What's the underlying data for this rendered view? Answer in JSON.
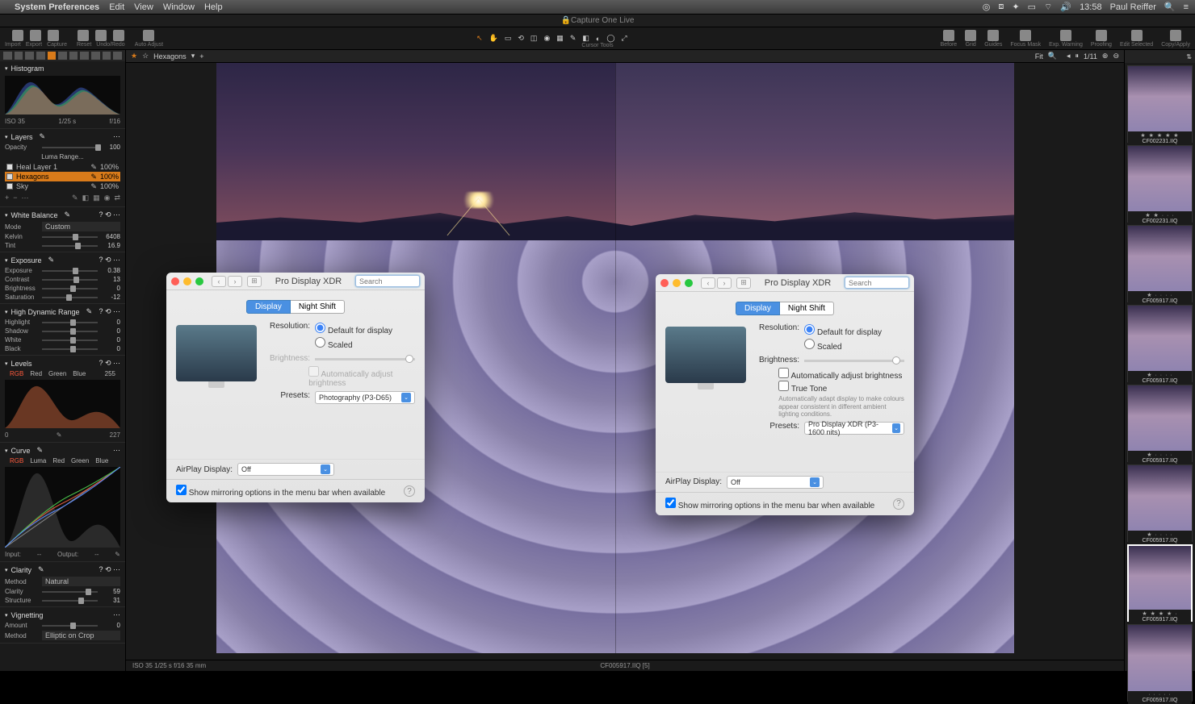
{
  "menubar": {
    "app": "System Preferences",
    "items": [
      "Edit",
      "View",
      "Window",
      "Help"
    ],
    "clock": "13:58",
    "user": "Paul Reiffer"
  },
  "app_title": "Capture One Live",
  "toolbar_left": [
    {
      "label": "Import"
    },
    {
      "label": "Export"
    },
    {
      "label": "Capture"
    }
  ],
  "toolbar_mid": [
    {
      "label": "Reset"
    },
    {
      "label": "Undo/Redo"
    }
  ],
  "toolbar_auto": "Auto Adjust",
  "cursor_tools_label": "Cursor Tools",
  "toolbar_right": [
    {
      "label": "Before"
    },
    {
      "label": "Grid"
    },
    {
      "label": "Guides"
    },
    {
      "label": "Focus Mask"
    },
    {
      "label": "Exp. Warning"
    },
    {
      "label": "Proofing"
    }
  ],
  "toolbar_far": [
    {
      "label": "Edit Selected"
    },
    {
      "label": "Copy/Apply"
    }
  ],
  "breadcrumb": {
    "name": "Hexagons"
  },
  "fit_label": "Fit",
  "counter": "1/11",
  "histogram": {
    "title": "Histogram",
    "iso": "ISO 35",
    "shutter": "1/25 s",
    "aperture": "f/16"
  },
  "layers": {
    "title": "Layers",
    "opacity_label": "Opacity",
    "opacity_val": "100",
    "luma": "Luma Range...",
    "list": [
      {
        "name": "Heal Layer 1",
        "val": "100%"
      },
      {
        "name": "Hexagons",
        "val": "100%"
      },
      {
        "name": "Sky",
        "val": "100%"
      }
    ]
  },
  "wb": {
    "title": "White Balance",
    "mode_label": "Mode",
    "mode": "Custom",
    "kelvin_label": "Kelvin",
    "kelvin": "6408",
    "tint_label": "Tint",
    "tint": "16.9"
  },
  "exposure": {
    "title": "Exposure",
    "rows": [
      {
        "label": "Exposure",
        "val": "0.38"
      },
      {
        "label": "Contrast",
        "val": "13"
      },
      {
        "label": "Brightness",
        "val": "0"
      },
      {
        "label": "Saturation",
        "val": "-12"
      }
    ]
  },
  "hdr": {
    "title": "High Dynamic Range",
    "rows": [
      {
        "label": "Highlight",
        "val": "0"
      },
      {
        "label": "Shadow",
        "val": "0"
      },
      {
        "label": "White",
        "val": "0"
      },
      {
        "label": "Black",
        "val": "0"
      }
    ]
  },
  "levels": {
    "title": "Levels",
    "channels": [
      "RGB",
      "Red",
      "Green",
      "Blue"
    ],
    "in": "0",
    "out": "255",
    "low": "0",
    "high": "227",
    "input_label": "Input:",
    "output_label": "Output:",
    "input_val": "--",
    "output_val": "--"
  },
  "curve": {
    "title": "Curve",
    "channels": [
      "RGB",
      "Luma",
      "Red",
      "Green",
      "Blue"
    ]
  },
  "clarity": {
    "title": "Clarity",
    "method_label": "Method",
    "method": "Natural",
    "rows": [
      {
        "label": "Clarity",
        "val": "59"
      },
      {
        "label": "Structure",
        "val": "31"
      }
    ]
  },
  "vignetting": {
    "title": "Vignetting",
    "amount_label": "Amount",
    "amount": "0",
    "method_label": "Method",
    "method": "Elliptic on Crop"
  },
  "footer": {
    "left": "ISO 35   1/25 s   f/16   35 mm",
    "center": "CF005917.IIQ [5]"
  },
  "thumbs": [
    {
      "name": "CF002231.IIQ",
      "stars": "★ ★ ★ ★ ★"
    },
    {
      "name": "CF002231.IIQ",
      "stars": "★ ★ · · ·"
    },
    {
      "name": "CF005917.IIQ",
      "stars": "★ · · · ·"
    },
    {
      "name": "CF005917.IIQ",
      "stars": "★ · · · ·"
    },
    {
      "name": "CF005917.IIQ",
      "stars": "★ · · · ·"
    },
    {
      "name": "CF005917.IIQ",
      "stars": "★ · · · ·"
    },
    {
      "name": "CF005917.IIQ",
      "stars": "★ ★ ★ ★ ·"
    },
    {
      "name": "CF005917.IIQ",
      "stars": "· · · · ·"
    }
  ],
  "pref_common": {
    "title": "Pro Display XDR",
    "search_ph": "Search",
    "tab_display": "Display",
    "tab_night": "Night Shift",
    "resolution": "Resolution:",
    "res_default": "Default for display",
    "res_scaled": "Scaled",
    "brightness": "Brightness:",
    "auto_bright": "Automatically adjust brightness",
    "true_tone": "True Tone",
    "true_tone_note": "Automatically adapt display to make colours appear consistent in different ambient lighting conditions.",
    "presets": "Presets:",
    "airplay": "AirPlay Display:",
    "airplay_off": "Off",
    "mirror": "Show mirroring options in the menu bar when available"
  },
  "pref_left": {
    "preset_value": "Photography (P3-D65)"
  },
  "pref_right": {
    "preset_value": "Pro Display XDR (P3-1600 nits)"
  }
}
